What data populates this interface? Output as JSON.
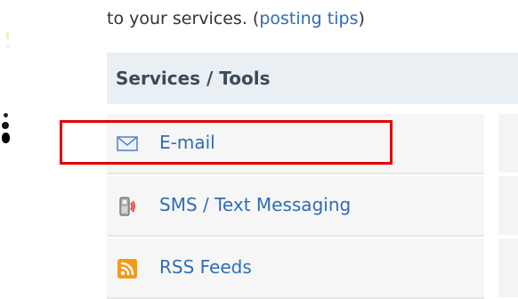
{
  "intro": {
    "text": "to your services. (",
    "link": "posting tips",
    "suffix": ")"
  },
  "services": {
    "title": "Services / Tools",
    "items": [
      {
        "label": "E-mail",
        "icon": "envelope-icon",
        "highlighted": true
      },
      {
        "label": "SMS / Text Messaging",
        "icon": "mobile-phone-icon",
        "highlighted": false
      },
      {
        "label": "RSS Feeds",
        "icon": "rss-icon",
        "highlighted": false
      }
    ]
  },
  "colors": {
    "link": "#2f6db5",
    "header_bg": "#eaeff4",
    "row_bg": "#f6f6f6",
    "highlight_border": "#e00000",
    "rss_orange": "#f29a1c"
  }
}
